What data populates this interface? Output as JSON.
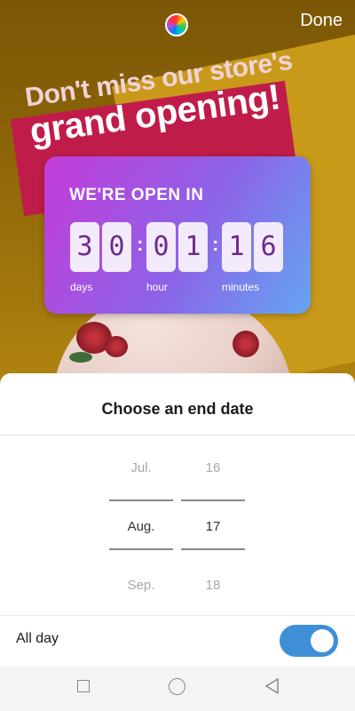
{
  "topbar": {
    "color_picker_icon": "color-wheel-icon",
    "done_label": "Done"
  },
  "background": {
    "banner_line1": "Don't miss our store's",
    "banner_line2": "grand opening!"
  },
  "sticker": {
    "title": "WE'RE OPEN IN",
    "digits": [
      "3",
      "0",
      "0",
      "1",
      "1",
      "6"
    ],
    "units": [
      "days",
      "hour",
      "minutes"
    ],
    "gradient": [
      "#c53bd9",
      "#8c63e8",
      "#64a5f2"
    ]
  },
  "sheet": {
    "title": "Choose an end date",
    "month_picker": {
      "prev": "Jul.",
      "selected": "Aug.",
      "next": "Sep."
    },
    "day_picker": {
      "prev": "16",
      "selected": "17",
      "next": "18"
    },
    "all_day_label": "All day",
    "all_day_on": true,
    "toggle_color": "#3f8fd6"
  },
  "navbar": {
    "icons": [
      "recent-apps-icon",
      "home-icon",
      "back-icon"
    ]
  }
}
